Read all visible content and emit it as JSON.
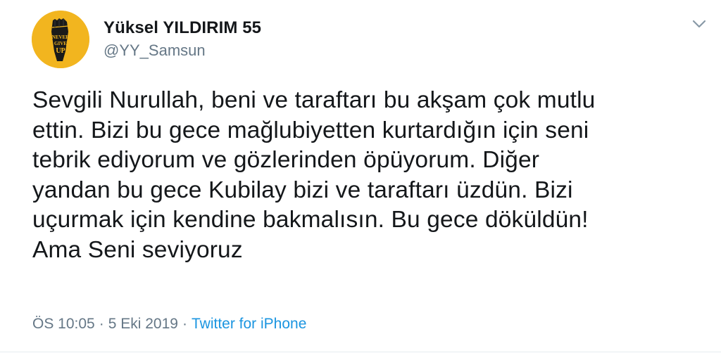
{
  "author": {
    "display_name": "Yüksel YILDIRIM 55",
    "handle": "@YY_Samsun",
    "avatar_text": "NEVER GIVE UP",
    "avatar_color": "#f2b51f"
  },
  "menu": {
    "icon": "chevron-down-icon"
  },
  "tweet": {
    "text": "Sevgili Nurullah, beni ve taraftarı bu akşam çok mutlu\nettin. Bizi bu gece mağlubiyetten kurtardığın için seni\ntebrik ediyorum ve gözlerinden öpüyorum. Diğer\nyandan bu gece Kubilay bizi ve taraftarı üzdün. Bizi\nuçurmak için kendine bakmalısın. Bu gece döküldün!\nAma Seni seviyoruz"
  },
  "meta": {
    "time": "ÖS 10:05",
    "date": "5 Eki 2019",
    "separator": "·",
    "source": "Twitter for iPhone",
    "source_color": "#1b95e0"
  }
}
